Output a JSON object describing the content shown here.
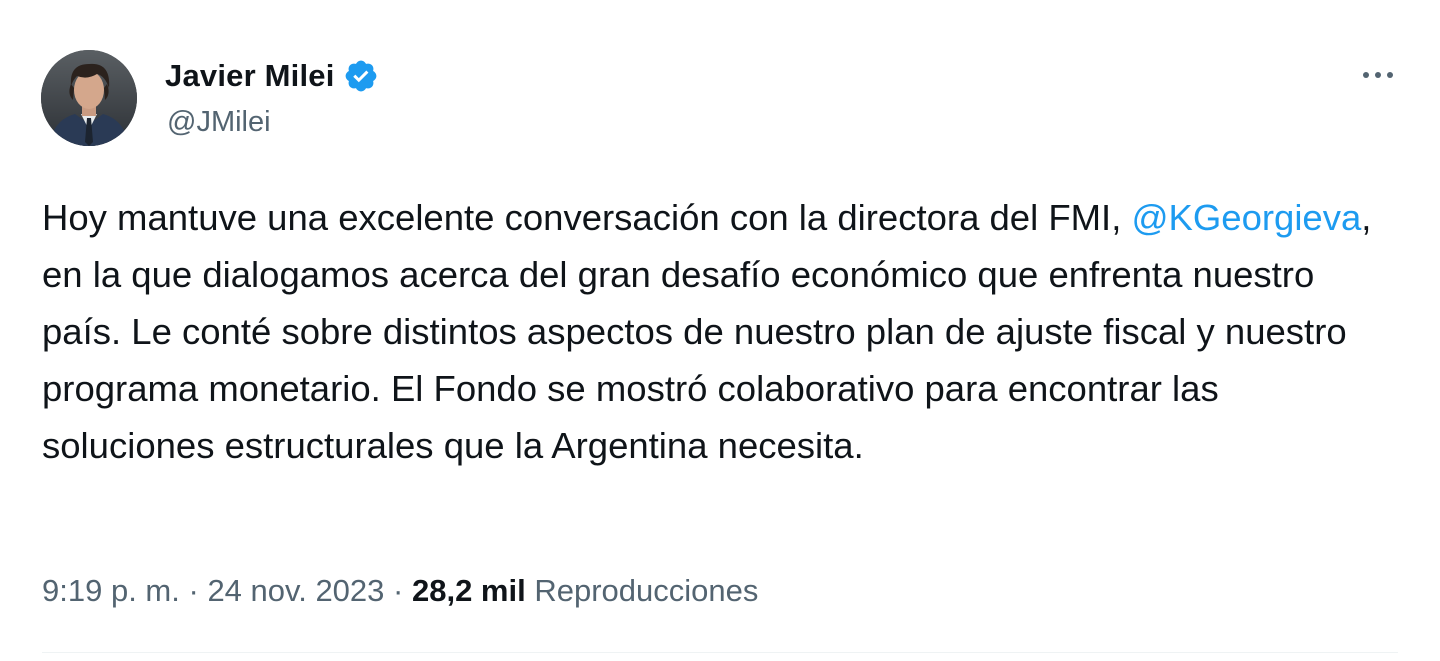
{
  "author": {
    "display_name": "Javier Milei",
    "handle": "@JMilei",
    "verified": true,
    "avatar_icon": "profile-photo"
  },
  "tweet": {
    "text_before_mention": "Hoy mantuve una excelente conversación con la directora del FMI, ",
    "mention": "@KGeorgieva",
    "text_after_mention": ", en la que dialogamos acerca del gran desafío económico que enfrenta nuestro país. Le conté sobre distintos aspectos de nuestro plan de ajuste fiscal y nuestro programa monetario. El Fondo se mostró colaborativo para encontrar las soluciones estructurales que la Argentina necesita."
  },
  "meta": {
    "time": "9:19 p. m.",
    "separator": "·",
    "date": "24 nov. 2023",
    "views_count": "28,2 mil",
    "views_label": "Reproducciones"
  },
  "colors": {
    "accent": "#1d9bf0",
    "text_primary": "#0f1419",
    "text_secondary": "#536471"
  },
  "icons": {
    "verified": "verified-badge-icon",
    "more": "more-options-icon"
  }
}
